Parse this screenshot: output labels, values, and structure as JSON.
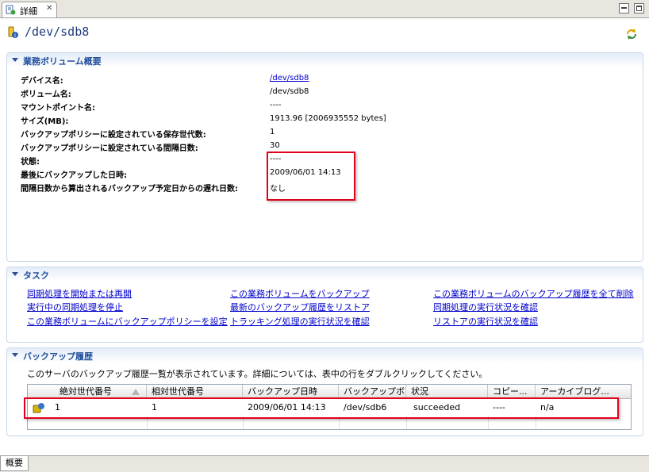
{
  "tab": {
    "label": "詳細",
    "close": "✕"
  },
  "header": {
    "title": "/dev/sdb8"
  },
  "overview": {
    "title": "業務ボリューム概要",
    "rows": [
      {
        "label": "デバイス名:",
        "value": "/dev/sdb8"
      },
      {
        "label": "ボリューム名:",
        "value": "/dev/sdb8"
      },
      {
        "label": "マウントポイント名:",
        "value": "----"
      },
      {
        "label": "サイズ(MB):",
        "value": "1913.96 [2006935552 bytes]"
      },
      {
        "label": "バックアップポリシーに設定されている保存世代数:",
        "value": "1"
      },
      {
        "label": "バックアップポリシーに設定されている間隔日数:",
        "value": "30"
      },
      {
        "label": "状態:",
        "value": "----"
      },
      {
        "label": "最後にバックアップした日時:",
        "value": "2009/06/01 14:13"
      },
      {
        "label": "間隔日数から算出されるバックアップ予定日からの遅れ日数:",
        "value": "なし"
      }
    ]
  },
  "tasks": {
    "title": "タスク",
    "col1": [
      "同期処理を開始または再開",
      "実行中の同期処理を停止",
      "この業務ボリュームにバックアップポリシーを設定"
    ],
    "col2": [
      "この業務ボリュームをバックアップ",
      "最新のバックアップ履歴をリストア",
      "トラッキング処理の実行状況を確認"
    ],
    "col3": [
      "この業務ボリュームのバックアップ履歴を全て削除",
      "同期処理の実行状況を確認",
      "リストアの実行状況を確認"
    ]
  },
  "history": {
    "title": "バックアップ履歴",
    "description": "このサーバのバックアップ履歴一覧が表示されています。詳細については、表中の行をダブルクリックしてください。",
    "columns": [
      "絶対世代番号",
      "相対世代番号",
      "バックアップ日時",
      "バックアップボ...",
      "状況",
      "コピー...",
      "アーカイブログ..."
    ],
    "rows": [
      [
        "1",
        "1",
        "2009/06/01 14:13",
        "/dev/sdb6",
        "succeeded",
        "----",
        "n/a"
      ]
    ]
  },
  "bottom_tab": {
    "label": "概要"
  },
  "colors": {
    "accent": "#1f4f9c",
    "link": "#0000cc",
    "highlight": "#e2001a"
  }
}
